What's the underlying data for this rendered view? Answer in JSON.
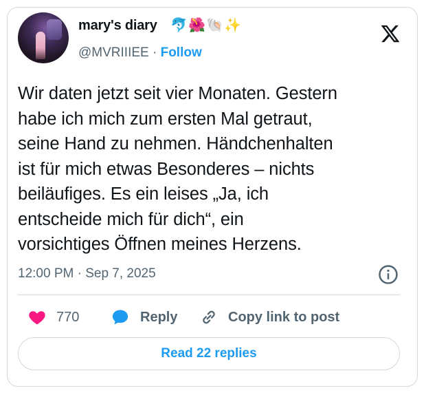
{
  "tweet": {
    "author": {
      "display_name": "mary's diary",
      "emojis": [
        "🐬",
        "🌺",
        "🐚",
        "✨"
      ],
      "handle": "@MVRIIIEE",
      "separator": "·",
      "follow_label": "Follow"
    },
    "body_lines": [
      "Wir daten jetzt seit vier Monaten. Gestern",
      "habe ich mich zum ersten Mal getraut,",
      "seine Hand zu nehmen. Händchenhalten",
      "ist für mich etwas Besonderes – nichts",
      "beiläufiges. Es ein leises „Ja, ich",
      "entscheide mich für dich“, ein",
      "vorsichtiges Öffnen meines Herzens."
    ],
    "timestamp": "12:00 PM · Sep 7, 2025",
    "actions": {
      "like_count": "770",
      "reply_label": "Reply",
      "copy_link_label": "Copy link to post"
    },
    "read_replies_label": "Read 22 replies"
  },
  "icons": {
    "brand": "x-logo-icon",
    "info": "info-icon",
    "like": "heart-icon",
    "reply": "speech-bubble-icon",
    "copy": "link-icon"
  },
  "colors": {
    "accent": "#1d9bf0",
    "heart": "#f91880",
    "text": "#0f1419",
    "secondary": "#536471",
    "border": "#cfd9de"
  }
}
